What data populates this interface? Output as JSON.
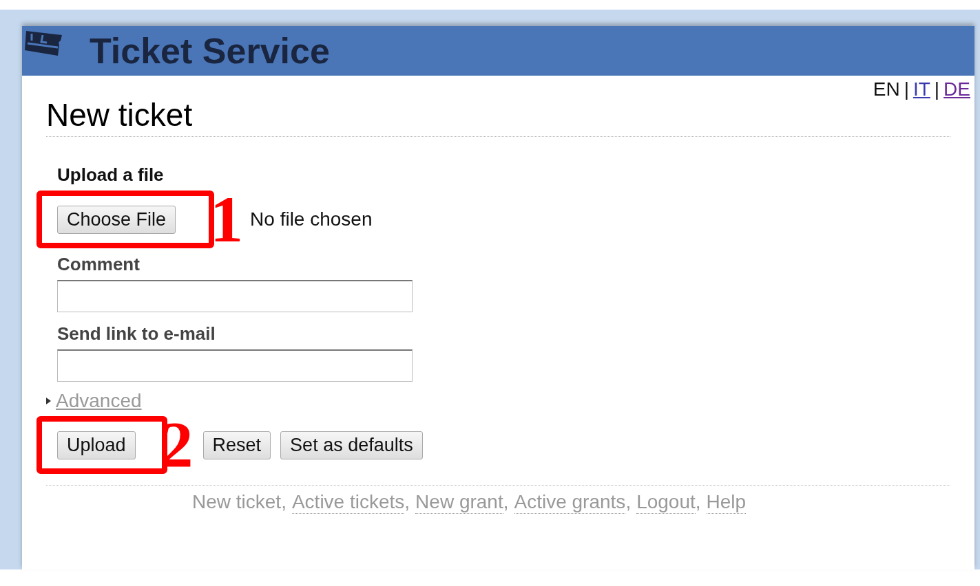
{
  "header": {
    "title": "Ticket Service"
  },
  "languages": {
    "separator": "|",
    "items": [
      {
        "label": "EN",
        "selected": true,
        "visited": false
      },
      {
        "label": "IT",
        "selected": false,
        "visited": false
      },
      {
        "label": "DE",
        "selected": false,
        "visited": true
      }
    ]
  },
  "page_title": "New ticket",
  "form": {
    "file": {
      "label": "Upload a file",
      "button": "Choose File",
      "status": "No file chosen",
      "callout": "1"
    },
    "fields": [
      {
        "label": "Comment"
      },
      {
        "label": "Send link to e-mail"
      }
    ],
    "advanced": {
      "label": "Advanced",
      "expanded": false
    },
    "buttons": [
      {
        "label": "Upload",
        "callout": "2"
      },
      {
        "label": "Reset"
      },
      {
        "label": "Set as defaults"
      }
    ]
  },
  "footer": {
    "separator": ",",
    "links": [
      {
        "label": "New ticket",
        "selected": true
      },
      {
        "label": "Active tickets",
        "selected": false
      },
      {
        "label": "New grant",
        "selected": false
      },
      {
        "label": "Active grants",
        "selected": false
      },
      {
        "label": "Logout",
        "selected": false
      },
      {
        "label": "Help",
        "selected": false
      }
    ]
  }
}
